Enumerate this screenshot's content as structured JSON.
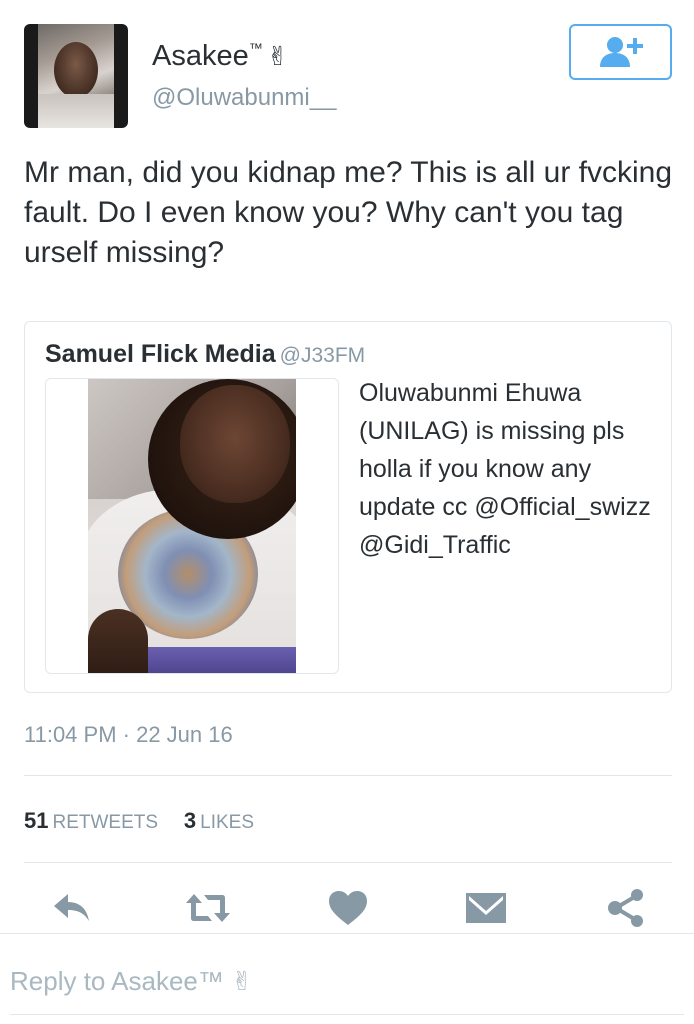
{
  "author": {
    "display_name": "Asakee",
    "tm": "™",
    "emoji": "✌",
    "handle": "@Oluwabunmi__"
  },
  "tweet": {
    "text": "Mr man, did you kidnap me? This is all ur fvcking fault. Do I even know you? Why can't you tag urself missing?"
  },
  "quoted": {
    "name": "Samuel Flick Media",
    "handle": "@J33FM",
    "text": "Oluwabunmi Ehuwa (UNILAG) is missing pls holla if you know any update cc @Official_swizz @Gidi_Traffic"
  },
  "meta": {
    "timestamp": "11:04 PM · 22 Jun 16"
  },
  "stats": {
    "retweets_count": "51",
    "retweets_label": "RETWEETS",
    "likes_count": "3",
    "likes_label": "LIKES"
  },
  "actions": [
    "reply-icon",
    "retweet-icon",
    "like-icon",
    "direct-message-icon",
    "share-icon"
  ],
  "reply": {
    "placeholder": "Reply to Asakee™ ✌"
  },
  "colors": {
    "accent": "#55acee",
    "icon_gray": "#8899a6",
    "text": "#292f33",
    "muted": "#8899a6",
    "border": "#e1e8ed"
  }
}
